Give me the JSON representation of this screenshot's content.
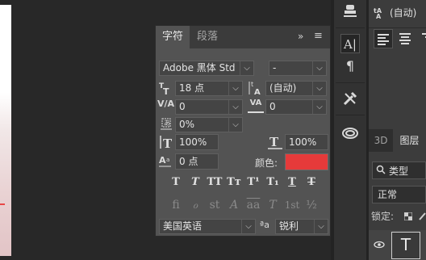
{
  "canvas": {
    "note": ""
  },
  "options_bar": {
    "font_size_value": "(自动)",
    "align_left_icon": "align-left-icon",
    "align_center_icon": "align-center-icon",
    "align_right_icon": "align-right-icon"
  },
  "character_panel": {
    "tabs": [
      "字符",
      "段落"
    ],
    "active_tab": "字符",
    "collapse_glyph": "»",
    "menu_glyph": "≡",
    "font_family": "Adobe 黑体 Std",
    "font_style": "-",
    "font_size": "18 点",
    "leading": "(自动)",
    "kerning": "0",
    "tracking": "0",
    "tsume": "0%",
    "vertical_scale": "100%",
    "horizontal_scale": "100%",
    "baseline_shift": "0 点",
    "color_label": "颜色:",
    "color_value": "#e63a3a",
    "type_style_buttons": [
      "T",
      "T",
      "TT",
      "Tт",
      "T¹",
      "T₁",
      "T",
      "T"
    ],
    "opentype_buttons": [
      "fi",
      "ℴ",
      "st",
      "A",
      "aa",
      "T",
      "1st",
      "½"
    ],
    "language": "美国英语",
    "aa_label": "ªa",
    "antialias": "锐利"
  },
  "toolbar": {
    "items": [
      "stamp-icon",
      "character-panel-icon",
      "paragraph-icon",
      "tools-icon",
      "cloud-libraries-icon"
    ],
    "labels": {
      "character": "A|",
      "paragraph": "¶"
    }
  },
  "layers_panel": {
    "tabs": [
      "3D",
      "图层"
    ],
    "search_label": "类型",
    "blend_mode": "正常",
    "lock_label": "锁定:",
    "layer_thumb": "T"
  }
}
